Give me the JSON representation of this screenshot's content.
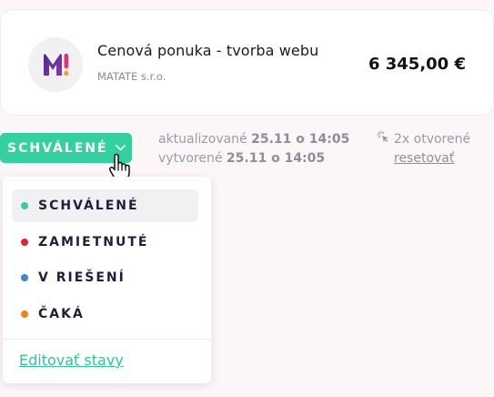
{
  "card": {
    "title": "Cenová ponuka - tvorba webu",
    "company": "MATATE s.r.o.",
    "amount": "6 345,00 €",
    "logo_icon": "matate-m-logo"
  },
  "status": {
    "current": "SCHVÁLENÉ",
    "color": "#33d0a0"
  },
  "meta": {
    "updated_label": "aktualizované",
    "updated_value": "25.11 o 14:05",
    "created_label": "vytvorené",
    "created_value": "25.11 o 14:05"
  },
  "opens": {
    "icon": "click-icon",
    "text": "2x otvorené",
    "reset_label": "resetovať"
  },
  "menu": {
    "items": [
      {
        "label": "SCHVÁLENÉ",
        "color": "#33d0a0",
        "active": true
      },
      {
        "label": "ZAMIETNUTÉ",
        "color": "#e0262b",
        "active": false
      },
      {
        "label": "V RIEŠENÍ",
        "color": "#3a86d8",
        "active": false
      },
      {
        "label": "ČAKÁ",
        "color": "#f17f24",
        "active": false
      }
    ],
    "edit_label": "Editovať stavy"
  }
}
